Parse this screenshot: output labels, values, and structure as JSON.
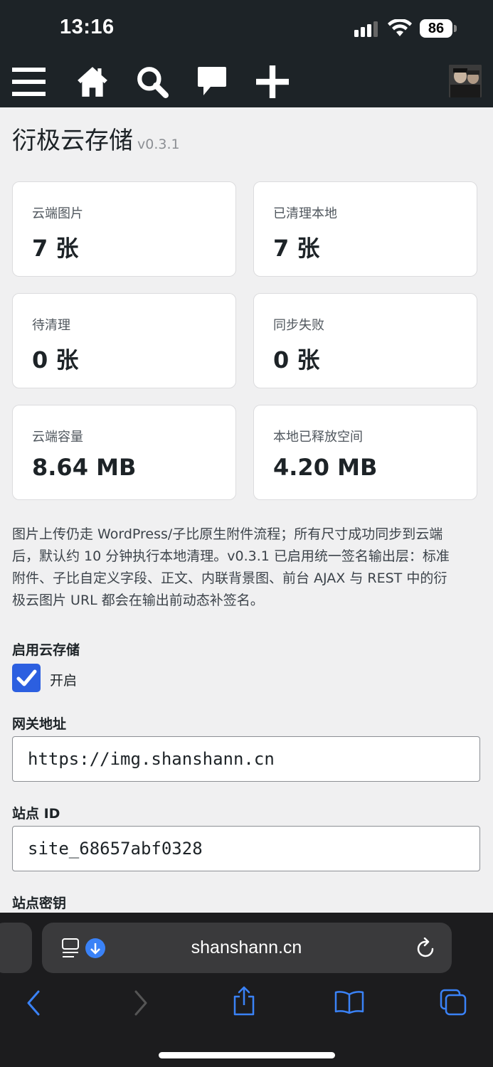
{
  "status": {
    "time": "13:16",
    "battery": "86"
  },
  "admin_bar": {
    "icons": [
      "menu-icon",
      "home-icon",
      "search-icon",
      "comment-icon",
      "plus-icon"
    ]
  },
  "page": {
    "title": "衍极云存储",
    "version": "v0.3.1"
  },
  "stats": [
    {
      "label": "云端图片",
      "value": "7 张"
    },
    {
      "label": "已清理本地",
      "value": "7 张"
    },
    {
      "label": "待清理",
      "value": "0 张"
    },
    {
      "label": "同步失败",
      "value": "0 张"
    },
    {
      "label": "云端容量",
      "value": "8.64 MB"
    },
    {
      "label": "本地已释放空间",
      "value": "4.20 MB"
    }
  ],
  "description_lines": [
    "图片上传仍走 WordPress/子比原生附件流程；所有尺寸成功同步到云端",
    "后，默认约 10 分钟执行本地清理。v0.3.1 已启用统一签名输出层：标准",
    "附件、子比自定义字段、正文、内联背景图、前台 AJAX 与 REST 中的衍",
    "极云图片 URL 都会在输出前动态补签名。"
  ],
  "form": {
    "enable_label": "启用云存储",
    "enable_checkbox_label": "开启",
    "gateway_label": "网关地址",
    "gateway_value": "https://img.shanshann.cn",
    "site_id_label": "站点 ID",
    "site_id_value": "site_68657abf0328",
    "site_secret_label": "站点密钥"
  },
  "browser": {
    "url": "shanshann.cn"
  },
  "colors": {
    "accent": "#2c5fe0",
    "safari_blue": "#3a82f7"
  }
}
